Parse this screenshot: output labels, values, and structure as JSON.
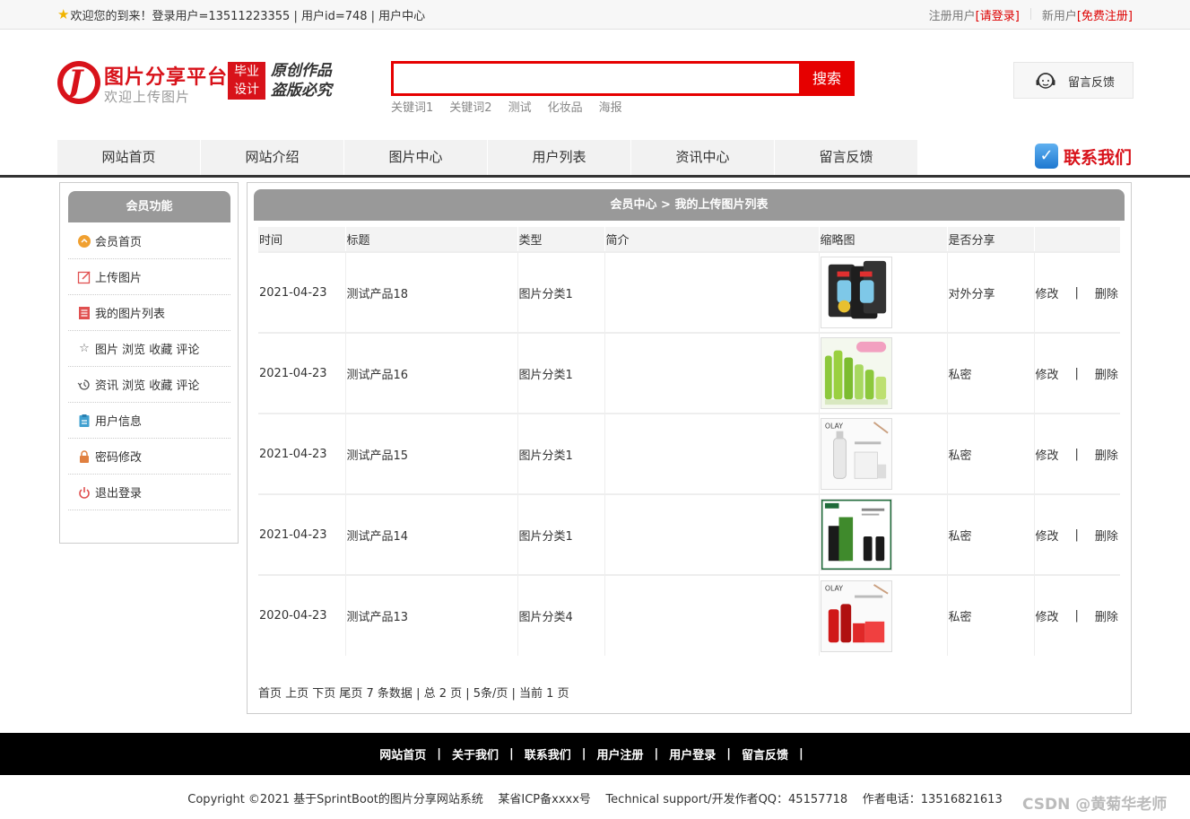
{
  "topbar": {
    "welcome": "欢迎您的到来！登录用户=13511223355 | 用户id=748 | 用户中心",
    "register_prefix": "注册用户",
    "login_link": "[请登录]",
    "new_prefix": "新用户",
    "register_link": "[免费注册]"
  },
  "logo": {
    "title": "图片分享平台",
    "subtitle": "欢迎上传图片",
    "badge_line1": "毕业",
    "badge_line2": "设计",
    "slogan_line1": "原创作品",
    "slogan_line2": "盗版必究"
  },
  "search": {
    "value": "",
    "placeholder": "",
    "button": "搜索",
    "keywords": [
      "关键词1",
      "关键词2",
      "测试",
      "化妆品",
      "海报"
    ]
  },
  "feedback": {
    "label": "留言反馈"
  },
  "nav": {
    "items": [
      "网站首页",
      "网站介绍",
      "图片中心",
      "用户列表",
      "资讯中心",
      "留言反馈"
    ],
    "contact": "联系我们"
  },
  "sidebar": {
    "title": "会员功能",
    "items": [
      {
        "label": "会员首页",
        "icon": "home-circle-icon",
        "color": "#f0a030"
      },
      {
        "label": "上传图片",
        "icon": "edit-icon",
        "color": "#e05050"
      },
      {
        "label": "我的图片列表",
        "icon": "list-icon",
        "color": "#e05050"
      },
      {
        "label": "图片 浏览 收藏 评论",
        "icon": "star-outline-icon",
        "color": "#666666"
      },
      {
        "label": "资讯 浏览 收藏 评论",
        "icon": "history-icon",
        "color": "#666666"
      },
      {
        "label": "用户信息",
        "icon": "clipboard-icon",
        "color": "#40a0d0"
      },
      {
        "label": "密码修改",
        "icon": "lock-icon",
        "color": "#e08040"
      },
      {
        "label": "退出登录",
        "icon": "power-icon",
        "color": "#e05050"
      }
    ]
  },
  "main": {
    "title": "会员中心 > 我的上传图片列表",
    "columns": [
      "时间",
      "标题",
      "类型",
      "简介",
      "缩略图",
      "是否分享",
      ""
    ],
    "rows": [
      {
        "time": "2021-04-23",
        "title": "测试产品18",
        "type": "图片分类1",
        "intro": "",
        "thumb": "face-mask-product",
        "share": "对外分享",
        "edit": "修改",
        "delete": "删除"
      },
      {
        "time": "2021-04-23",
        "title": "测试产品16",
        "type": "图片分类1",
        "intro": "",
        "thumb": "green-skincare-set",
        "share": "私密",
        "edit": "修改",
        "delete": "删除"
      },
      {
        "time": "2021-04-23",
        "title": "测试产品15",
        "type": "图片分类1",
        "intro": "",
        "thumb": "olay-white-serum",
        "share": "私密",
        "edit": "修改",
        "delete": "删除"
      },
      {
        "time": "2021-04-23",
        "title": "测试产品14",
        "type": "图片分类1",
        "intro": "",
        "thumb": "green-men-skincare",
        "share": "私密",
        "edit": "修改",
        "delete": "删除"
      },
      {
        "time": "2020-04-23",
        "title": "测试产品13",
        "type": "图片分类4",
        "intro": "",
        "thumb": "olay-red-set",
        "share": "私密",
        "edit": "修改",
        "delete": "删除"
      }
    ],
    "pager": "首页 上页 下页 尾页 7 条数据 | 总 2 页 | 5条/页 | 当前 1 页"
  },
  "footer": {
    "links": [
      "网站首页",
      "关于我们",
      "联系我们",
      "用户注册",
      "用户登录",
      "留言反馈"
    ],
    "copyright": "Copyright ©2021 基于SprintBoot的图片分享网站系统    某省ICP备xxxx号    Technical support/开发作者QQ：45157718    作者电话：13516821613",
    "watermark": "CSDN @黄菊华老师"
  },
  "colors": {
    "brand_red": "#d8121a",
    "search_red": "#e60000",
    "header_gray": "#999999"
  }
}
